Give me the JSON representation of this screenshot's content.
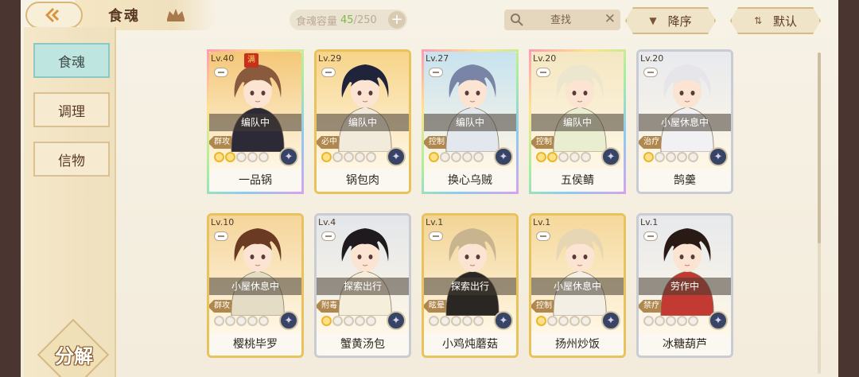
{
  "header": {
    "title": "食魂",
    "capacity_label": "食魂容量",
    "capacity_current": "45",
    "capacity_total": "/250",
    "search_placeholder": "查找",
    "sort_label": "降序",
    "default_label": "默认"
  },
  "sidebar": {
    "items": [
      {
        "label": "食魂",
        "active": true
      },
      {
        "label": "调理",
        "active": false
      },
      {
        "label": "信物",
        "active": false
      }
    ],
    "decompose_label": "分解"
  },
  "cards": [
    {
      "level": "Lv.40",
      "full": "满",
      "status": "编队中",
      "role": "群攻",
      "stars_lit": 2,
      "name": "一品锅",
      "frame": "rainbow",
      "bg": "#f4c777",
      "hair": "#8a5a3c",
      "robe": "#2c2a36"
    },
    {
      "level": "Lv.29",
      "status": "编队中",
      "role": "必中",
      "stars_lit": 1,
      "name": "锅包肉",
      "frame": "gold",
      "bg": "#f7d489",
      "hair": "#20243a",
      "robe": "#f2eadb"
    },
    {
      "level": "Lv.27",
      "status": "编队中",
      "role": "控制",
      "stars_lit": 1,
      "name": "换心乌贼",
      "frame": "rainbow",
      "bg": "#c7e2ef",
      "hair": "#7a84a6",
      "robe": "#e2e8ee"
    },
    {
      "level": "Lv.20",
      "status": "编队中",
      "role": "控制",
      "stars_lit": 2,
      "name": "五侯鲭",
      "frame": "rainbow",
      "bg": "#f4e7c2",
      "hair": "#ede6cf",
      "robe": "#e9eed0"
    },
    {
      "level": "Lv.20",
      "status": "小屋休息中",
      "role": "治疗",
      "stars_lit": 1,
      "name": "鹄羹",
      "frame": "silver",
      "bg": "#e8eaee",
      "hair": "#e5e5ea",
      "robe": "#f1f1f3"
    },
    {
      "level": "Lv.10",
      "status": "小屋休息中",
      "role": "群攻",
      "stars_lit": 0,
      "name": "樱桃毕罗",
      "frame": "gold",
      "bg": "#f5d59a",
      "hair": "#6a3a22",
      "robe": "#e5dcc6"
    },
    {
      "level": "Lv.4",
      "status": "探索出行",
      "role": "附毒",
      "stars_lit": 1,
      "name": "蟹黄汤包",
      "frame": "silver",
      "bg": "#e3e6ea",
      "hair": "#1e1a1e",
      "robe": "#f5eeda"
    },
    {
      "level": "Lv.1",
      "status": "探索出行",
      "role": "眩晕",
      "stars_lit": 0,
      "name": "小鸡炖蘑菇",
      "frame": "gold",
      "bg": "#f2d494",
      "hair": "#c8b48e",
      "robe": "#2a2624"
    },
    {
      "level": "Lv.1",
      "status": "小屋休息中",
      "role": "控制",
      "stars_lit": 1,
      "name": "扬州炒饭",
      "frame": "gold",
      "bg": "#f5d89a",
      "hair": "#e6d6b4",
      "robe": "#f3efe4"
    },
    {
      "level": "Lv.1",
      "status": "劳作中",
      "role": "禁疗",
      "stars_lit": 0,
      "name": "冰糖葫芦",
      "frame": "silver",
      "bg": "#e7e9ed",
      "hair": "#2a1a16",
      "robe": "#c23a32"
    }
  ]
}
